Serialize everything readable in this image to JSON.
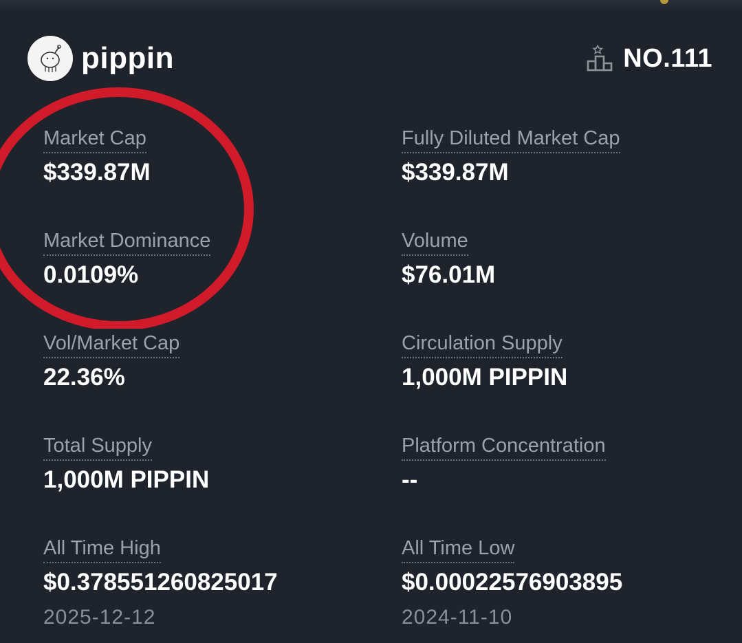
{
  "coin": {
    "name": "pippin",
    "rank": "NO.111"
  },
  "stats": [
    {
      "label": "Market Cap",
      "value": "$339.87M"
    },
    {
      "label": "Fully Diluted Market Cap",
      "value": "$339.87M"
    },
    {
      "label": "Market Dominance",
      "value": "0.0109%"
    },
    {
      "label": "Volume",
      "value": "$76.01M"
    },
    {
      "label": "Vol/Market Cap",
      "value": "22.36%"
    },
    {
      "label": "Circulation Supply",
      "value": "1,000M PIPPIN"
    },
    {
      "label": "Total Supply",
      "value": "1,000M PIPPIN"
    },
    {
      "label": "Platform Concentration",
      "value": "--"
    },
    {
      "label": "All Time High",
      "value": "$0.378551260825017",
      "date": "2025-12-12"
    },
    {
      "label": "All Time Low",
      "value": "$0.00022576903895",
      "date": "2024-11-10"
    }
  ],
  "icons": {
    "logo": "pippin-unicorn-logo",
    "rank": "podium-icon"
  },
  "colors": {
    "background": "#1f232b",
    "label": "#9ba2ad",
    "annotation_circle": "#d11a2a"
  }
}
